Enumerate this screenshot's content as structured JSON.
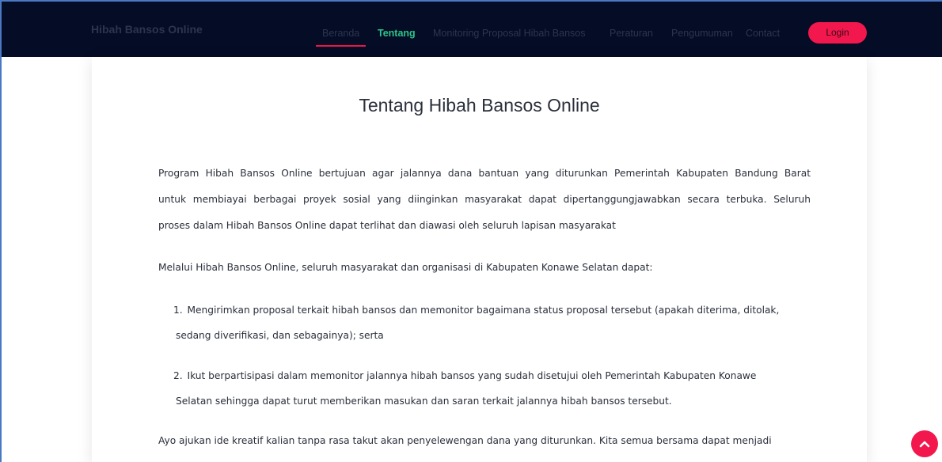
{
  "brand": "Hibah Bansos Online",
  "nav": {
    "items": [
      {
        "label": "Beranda"
      },
      {
        "label": "Tentang"
      },
      {
        "label": "Monitoring Proposal Hibah Bansos"
      },
      {
        "label": "Peraturan"
      },
      {
        "label": "Pengumuman"
      },
      {
        "label": "Contact"
      }
    ],
    "login_label": "Login"
  },
  "content": {
    "title": "Tentang Hibah Bansos Online",
    "para1_lines": [
      "Program Hibah Bansos Online bertujuan agar jalannya dana bantuan yang diturunkan Pemerintah Kabupaten Bandung Barat",
      "untuk membiayai berbagai proyek sosial yang diinginkan masyarakat dapat dipertanggungjawabkan secara terbuka. Seluruh",
      "proses dalam Hibah Bansos Online dapat terlihat dan diawasi oleh seluruh lapisan masyarakat"
    ],
    "para2": "Melalui Hibah Bansos Online, seluruh masyarakat dan organisasi di Kabupaten Konawe Selatan dapat:",
    "list": [
      {
        "num": "1.",
        "lines": [
          "Mengirimkan proposal terkait hibah bansos dan memonitor bagaimana status proposal tersebut (apakah diterima, ditolak,",
          "sedang diverifikasi, dan sebagainya); serta"
        ]
      },
      {
        "num": "2.",
        "lines": [
          "Ikut berpartisipasi dalam memonitor jalannya hibah bansos yang sudah disetujui oleh Pemerintah Kabupaten Konawe",
          "Selatan sehingga dapat turut memberikan masukan dan saran terkait jalannya hibah bansos tersebut."
        ]
      }
    ],
    "para3": "Ayo ajukan ide kreatif kalian tanpa rasa takut akan penyelewengan dana yang diturunkan. Kita semua bersama dapat menjadi"
  },
  "colors": {
    "navbar_bg": "#050c25",
    "accent": "#f2184d",
    "active_nav": "#2bc48a"
  },
  "icons": {
    "scroll_top": "chevron-up-icon"
  }
}
